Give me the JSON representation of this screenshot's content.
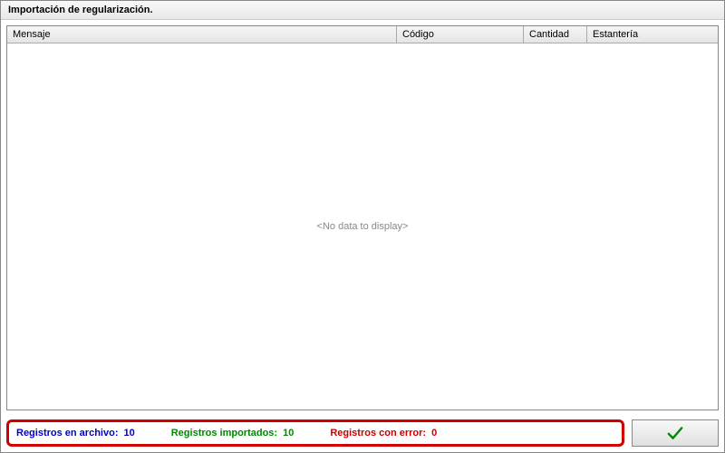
{
  "window": {
    "title": "Importación de regularización."
  },
  "grid": {
    "headers": {
      "mensaje": "Mensaje",
      "codigo": "Código",
      "cantidad": "Cantidad",
      "estanteria": "Estantería"
    },
    "empty_text": "<No data to display>"
  },
  "status": {
    "archivo_label": "Registros en archivo:",
    "archivo_value": "10",
    "importados_label": "Registros importados:",
    "importados_value": "10",
    "error_label": "Registros con error:",
    "error_value": "0"
  },
  "colors": {
    "highlight_border": "#d00000",
    "status_blue": "#0000cc",
    "status_green": "#008800",
    "status_red": "#cc0000"
  },
  "icons": {
    "ok": "checkmark-icon"
  }
}
